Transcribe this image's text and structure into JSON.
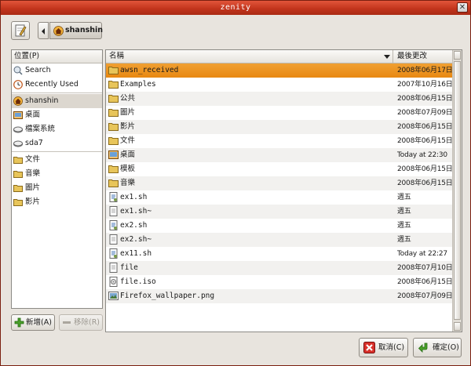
{
  "window": {
    "title": "zenity",
    "close_glyph": "✕"
  },
  "pathbar": {
    "crumb": "shanshin"
  },
  "places": {
    "header": "位置(P)",
    "items": [
      {
        "label": "Search",
        "icon": "search-icon"
      },
      {
        "label": "Recently Used",
        "icon": "recent-icon"
      },
      {
        "label": "shanshin",
        "icon": "home-icon",
        "selected": true
      },
      {
        "label": "桌面",
        "icon": "desktop-icon"
      },
      {
        "label": "檔案系統",
        "icon": "drive-icon"
      },
      {
        "label": "sda7",
        "icon": "drive-icon"
      },
      {
        "label": "文件",
        "icon": "folder-icon"
      },
      {
        "label": "音樂",
        "icon": "folder-icon"
      },
      {
        "label": "圖片",
        "icon": "folder-icon"
      },
      {
        "label": "影片",
        "icon": "folder-icon"
      }
    ],
    "add_label": "新增(A)",
    "remove_label": "移除(R)"
  },
  "files": {
    "col_name": "名稱",
    "col_modified": "最後更改",
    "rows": [
      {
        "name": "awsn_received",
        "modified": "2008年06月17日",
        "icon": "folder-icon",
        "selected": true
      },
      {
        "name": "Examples",
        "modified": "2007年10月16日",
        "icon": "folder-icon"
      },
      {
        "name": "公共",
        "modified": "2008年06月15日",
        "icon": "folder-icon"
      },
      {
        "name": "圖片",
        "modified": "2008年07月09日",
        "icon": "folder-icon"
      },
      {
        "name": "影片",
        "modified": "2008年06月15日",
        "icon": "folder-icon"
      },
      {
        "name": "文件",
        "modified": "2008年06月15日",
        "icon": "folder-icon"
      },
      {
        "name": "桌面",
        "modified": "Today at 22:30",
        "icon": "desktop-icon"
      },
      {
        "name": "模板",
        "modified": "2008年06月15日",
        "icon": "folder-icon"
      },
      {
        "name": "音樂",
        "modified": "2008年06月15日",
        "icon": "folder-icon"
      },
      {
        "name": "ex1.sh",
        "modified": "週五",
        "icon": "script-icon"
      },
      {
        "name": "ex1.sh~",
        "modified": "週五",
        "icon": "text-file-icon"
      },
      {
        "name": "ex2.sh",
        "modified": "週五",
        "icon": "script-icon"
      },
      {
        "name": "ex2.sh~",
        "modified": "週五",
        "icon": "text-file-icon"
      },
      {
        "name": "ex11.sh",
        "modified": "Today at 22:27",
        "icon": "script-icon"
      },
      {
        "name": "file",
        "modified": "2008年07月10日",
        "icon": "text-file-icon"
      },
      {
        "name": "file.iso",
        "modified": "2008年06月15日",
        "icon": "disc-image-icon"
      },
      {
        "name": "Firefox_wallpaper.png",
        "modified": "2008年07月09日",
        "icon": "image-file-icon"
      }
    ]
  },
  "buttons": {
    "cancel_label": "取消(C)",
    "ok_label": "確定(O)"
  },
  "colors": {
    "titlebar": "#c3351d",
    "selection": "#e88812",
    "folder": "#e8c55a"
  }
}
